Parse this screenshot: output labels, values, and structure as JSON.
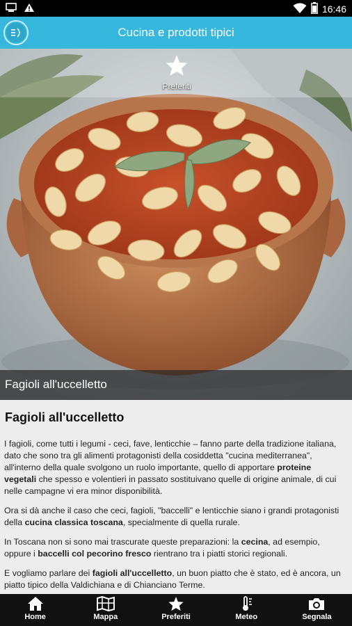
{
  "status_bar": {
    "time": "16:46",
    "left_icons": [
      "screen-icon",
      "warning-icon"
    ],
    "right_icons": [
      "wifi-icon",
      "battery-icon"
    ]
  },
  "app_bar": {
    "title": "Cucina e prodotti tipici"
  },
  "hero": {
    "favorite_label": "Preferiti",
    "caption": "Fagioli all'uccelletto"
  },
  "article": {
    "title": "Fagioli all'uccelletto",
    "p1_a": "I fagioli, come tutti i legumi - ceci, fave, lenticchie – fanno parte della tradizione italiana, dato che sono tra gli alimenti protagonisti della cosiddetta \"cucina mediterranea\", all'interno della quale svolgono un ruolo importante, quello di apportare ",
    "p1_b": "proteine vegetali",
    "p1_c": " che spesso e volentieri in passato sostituivano quelle di origine animale, di cui nelle campagne vi era minor disponibilità.",
    "p2_a": "Ora si dà anche il caso che ceci, fagioli, \"baccelli\" e lenticchie siano i grandi protagonisti della ",
    "p2_b": "cucina classica toscana",
    "p2_c": ", specialmente di quella rurale.",
    "p3_a": "In Toscana non si sono mai trascurate queste preparazioni: la ",
    "p3_b": "cecina",
    "p3_c": ", ad esempio, oppure i ",
    "p3_d": "baccelli col pecorino fresco",
    "p3_e": " rientrano tra i piatti storici regionali.",
    "p4_a": "E vogliamo parlare dei ",
    "p4_b": "fagioli all'uccelletto",
    "p4_c": ", un buon piatto che è stato, ed è ancora, un piatto tipico della Valdichiana e di Chianciano Terme."
  },
  "bottom_nav": {
    "items": [
      {
        "label": "Home",
        "icon": "home-icon"
      },
      {
        "label": "Mappa",
        "icon": "map-icon"
      },
      {
        "label": "Preferiti",
        "icon": "star-icon"
      },
      {
        "label": "Meteo",
        "icon": "weather-icon"
      },
      {
        "label": "Segnala",
        "icon": "camera-icon"
      }
    ]
  },
  "colors": {
    "app_bar": "#35b7de",
    "status_bar": "#000000",
    "bottom_nav": "#111111",
    "content_bg": "#ededed"
  }
}
